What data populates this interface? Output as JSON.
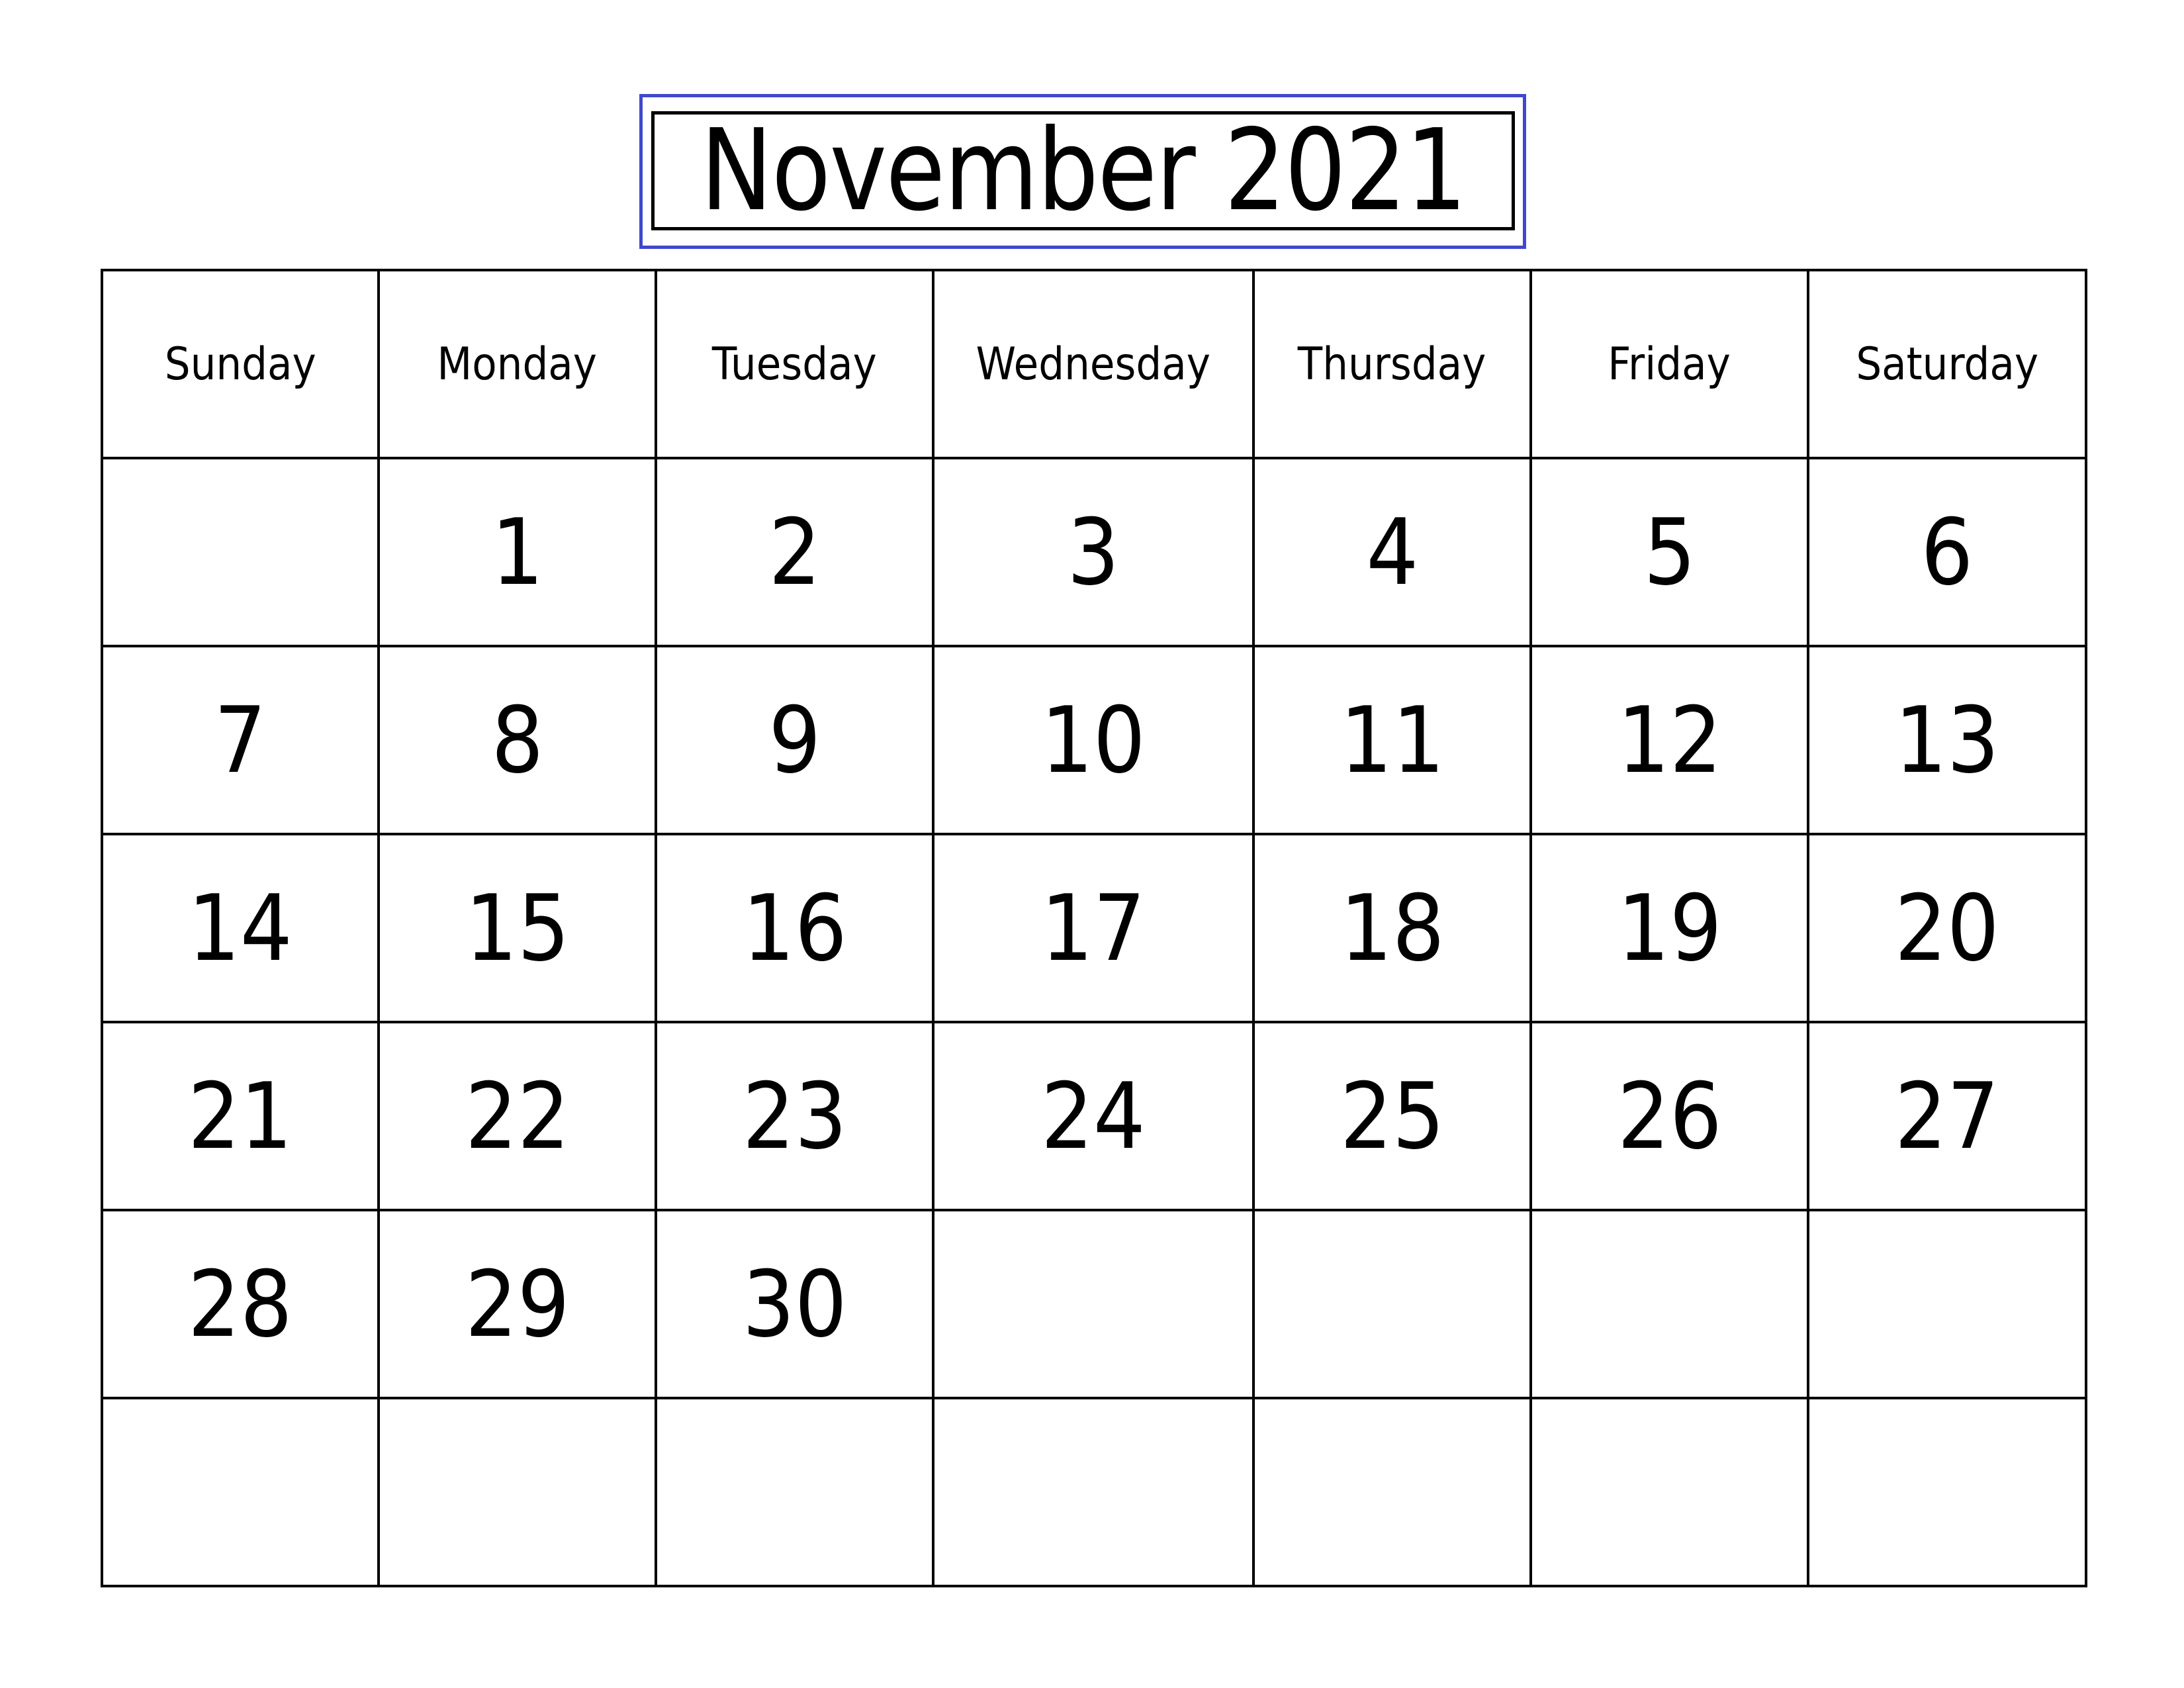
{
  "calendar": {
    "title": "November 2021",
    "accent_color": "#4048CC",
    "weekdays": [
      "Sunday",
      "Monday",
      "Tuesday",
      "Wednesday",
      "Thursday",
      "Friday",
      "Saturday"
    ],
    "weeks": [
      [
        "",
        "1",
        "2",
        "3",
        "4",
        "5",
        "6"
      ],
      [
        "7",
        "8",
        "9",
        "10",
        "11",
        "12",
        "13"
      ],
      [
        "14",
        "15",
        "16",
        "17",
        "18",
        "19",
        "20"
      ],
      [
        "21",
        "22",
        "23",
        "24",
        "25",
        "26",
        "27"
      ],
      [
        "28",
        "29",
        "30",
        "",
        "",
        "",
        ""
      ],
      [
        "",
        "",
        "",
        "",
        "",
        "",
        ""
      ]
    ]
  }
}
